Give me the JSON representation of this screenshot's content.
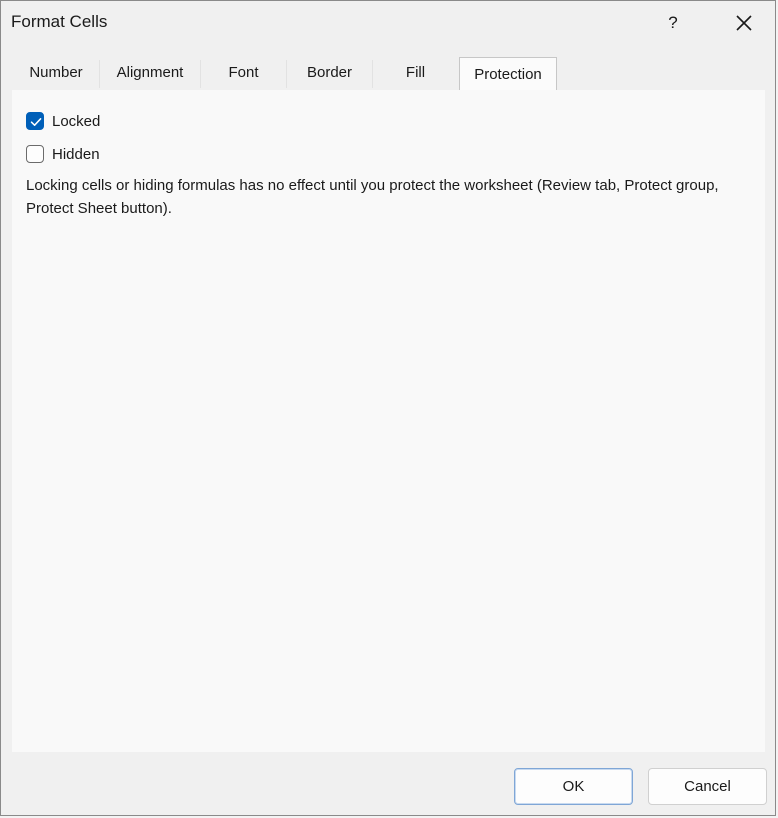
{
  "window": {
    "title": "Format Cells",
    "help_label": "?",
    "close_icon": "close-icon"
  },
  "tabs": [
    {
      "label": "Number",
      "active": false
    },
    {
      "label": "Alignment",
      "active": false
    },
    {
      "label": "Font",
      "active": false
    },
    {
      "label": "Border",
      "active": false
    },
    {
      "label": "Fill",
      "active": false
    },
    {
      "label": "Protection",
      "active": true
    }
  ],
  "protection": {
    "locked": {
      "label": "Locked",
      "checked": true
    },
    "hidden": {
      "label": "Hidden",
      "checked": false
    },
    "description": "Locking cells or hiding formulas has no effect until you protect the worksheet (Review tab, Protect group, Protect Sheet button)."
  },
  "buttons": {
    "ok": "OK",
    "cancel": "Cancel"
  },
  "colors": {
    "accent": "#005fb8",
    "panel_bg": "#f9f9f9",
    "dialog_bg": "#f0f0f0"
  }
}
